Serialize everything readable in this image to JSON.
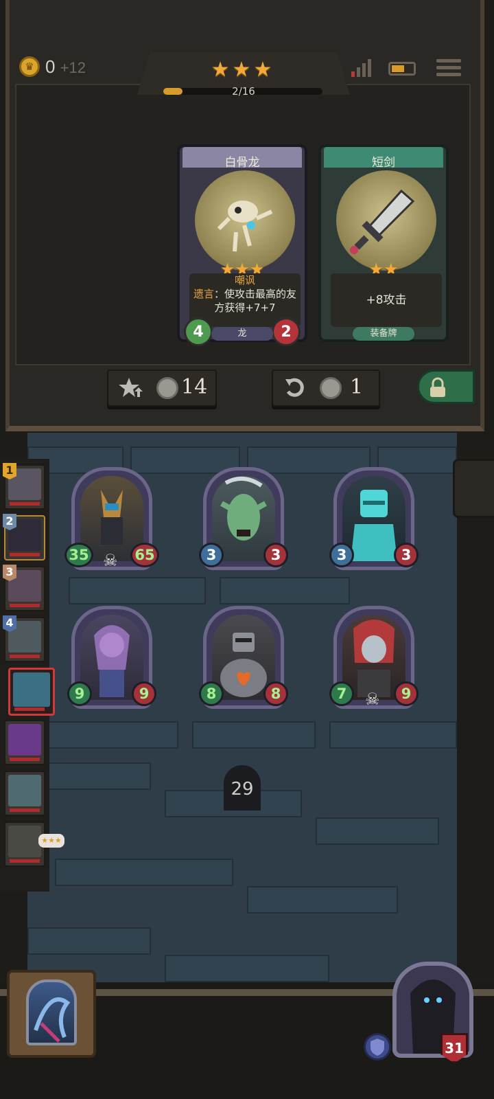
{
  "hud": {
    "gold": "0",
    "gold_income": "+12",
    "tier_stars": "★★★",
    "tier_progress": "2/16",
    "icons": [
      "coin-icon",
      "signal-icon",
      "battery-icon",
      "menu-icon"
    ]
  },
  "shop": {
    "cards": [
      {
        "title": "白骨龙",
        "stars": "★★★",
        "keyword": "嘲讽",
        "ability_label": "遗言",
        "ability_text": "：使攻击最高的友方获得+7+7",
        "attack": "4",
        "health": "2",
        "tribe": "龙"
      },
      {
        "title": "短剑",
        "stars": "★★",
        "text": "+8攻击",
        "type": "装备牌"
      }
    ],
    "upgrade_cost": "14",
    "refresh_cost": "1"
  },
  "board": {
    "minions": [
      {
        "attack": "35",
        "health": "65"
      },
      {
        "attack": "3",
        "health": "3"
      },
      {
        "attack": "3",
        "health": "3"
      },
      {
        "attack": "9",
        "health": "9"
      },
      {
        "attack": "8",
        "health": "8"
      },
      {
        "attack": "7",
        "health": "9"
      }
    ],
    "turn": "29"
  },
  "sidebar": {
    "ranks": [
      "1",
      "2",
      "3",
      "4"
    ],
    "badge": "★★★"
  },
  "hero": {
    "health": "31"
  },
  "colors": {
    "accent_gold": "#f2a93b",
    "attack": "#3d6f9a",
    "health": "#a3323a",
    "board": "#2e3d47"
  }
}
